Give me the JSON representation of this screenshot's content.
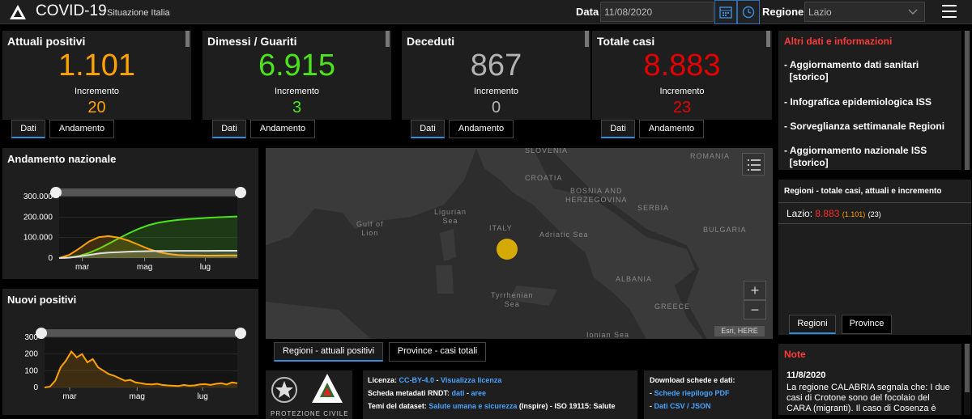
{
  "header": {
    "title": "COVID-19",
    "subtitle": "Situazione Italia",
    "date_label": "Data",
    "date_value": "11/08/2020",
    "region_label": "Regione",
    "region_value": "Lazio"
  },
  "cards": [
    {
      "title": "Attuali positivi",
      "value": "1.101",
      "inc_label": "Incremento",
      "inc_value": "20",
      "color": "#ffa200",
      "tabs": [
        "Dati",
        "Andamento"
      ]
    },
    {
      "title": "Dimessi / Guariti",
      "value": "6.915",
      "inc_label": "Incremento",
      "inc_value": "3",
      "color": "#4be31a",
      "tabs": [
        "Dati",
        "Andamento"
      ]
    },
    {
      "title": "Deceduti",
      "value": "867",
      "inc_label": "Incremento",
      "inc_value": "0",
      "color": "#b3b3b3",
      "tabs": [
        "Dati",
        "Andamento"
      ]
    },
    {
      "title": "Totale casi",
      "value": "8.883",
      "inc_label": "Incremento",
      "inc_value": "23",
      "color": "#e30000",
      "tabs": [
        "Dati",
        "Andamento"
      ]
    }
  ],
  "andamento": {
    "title": "Andamento nazionale"
  },
  "nuovi": {
    "title": "Nuovi positivi"
  },
  "chart_data": [
    {
      "type": "line",
      "title": "Andamento nazionale",
      "ylim": [
        0,
        300000
      ],
      "yticks": [
        "300.000",
        "200.000",
        "100.000",
        "0"
      ],
      "xticks": [
        "mar",
        "mag",
        "lug"
      ],
      "x": [
        0,
        10,
        20,
        30,
        40,
        50,
        60,
        70,
        80,
        90,
        100,
        110,
        120,
        130,
        140,
        150,
        160,
        170,
        180
      ],
      "series": [
        {
          "color": "#4be31a",
          "values": [
            0,
            2000,
            10000,
            25000,
            45000,
            70000,
            95000,
            120000,
            142000,
            160000,
            172000,
            180000,
            186000,
            190000,
            193000,
            196000,
            199000,
            201000,
            203000
          ]
        },
        {
          "color": "#ffa200",
          "values": [
            500,
            15000,
            45000,
            80000,
            102000,
            107000,
            100000,
            85000,
            65000,
            45000,
            30000,
            20000,
            15000,
            13000,
            12500,
            12000,
            12200,
            12500,
            13000
          ]
        },
        {
          "color": "#e0e0e0",
          "values": [
            0,
            2000,
            8000,
            15000,
            22000,
            27000,
            29000,
            31000,
            32500,
            33500,
            34200,
            34700,
            35000,
            35100,
            35200,
            35300,
            35350,
            35400,
            35450
          ]
        }
      ]
    },
    {
      "type": "line",
      "title": "Nuovi positivi",
      "ylim": [
        0,
        300
      ],
      "yticks": [
        "300",
        "200",
        "100",
        "0"
      ],
      "xticks": [
        "mar",
        "mag",
        "lug"
      ],
      "x": [
        0,
        5,
        10,
        15,
        20,
        25,
        30,
        35,
        40,
        45,
        50,
        55,
        60,
        65,
        70,
        75,
        80,
        85,
        90,
        95,
        100,
        105,
        110,
        115,
        120,
        125,
        130,
        135,
        140,
        145,
        150,
        155,
        160,
        165,
        170,
        175,
        180
      ],
      "series": [
        {
          "color": "#ffa200",
          "values": [
            0,
            5,
            40,
            120,
            160,
            215,
            180,
            200,
            150,
            170,
            120,
            100,
            80,
            70,
            55,
            40,
            45,
            30,
            25,
            20,
            18,
            22,
            15,
            12,
            10,
            8,
            15,
            10,
            12,
            18,
            20,
            15,
            22,
            25,
            18,
            30,
            25
          ]
        }
      ]
    }
  ],
  "map": {
    "labels": [
      "SLOVENIA",
      "CROATIA",
      "BOSNIA AND\nHERZEGOVINA",
      "SERBIA",
      "ROMANIA",
      "BULGARIA",
      "ITALY",
      "Ligurian\nSea",
      "Gulf of\nLion",
      "Adriatic Sea",
      "ALBANIA",
      "GREECE",
      "Tyrrhenian\nSea",
      "Ionian Sea"
    ],
    "attribution": "Esri, HERE",
    "zoom_in": "+",
    "zoom_out": "−",
    "tabs": [
      "Regioni - attuali positivi",
      "Province - casi totali"
    ]
  },
  "info": {
    "title": "Altri dati e informazioni",
    "links": [
      "- Aggiornamento dati sanitari\n  [storico]",
      "- Infografica epidemiologica ISS",
      "- Sorveglianza settimanale Regioni",
      "- Aggiornamento nazionale ISS\n  [storico]"
    ]
  },
  "regioni": {
    "title": "Regioni - totale casi, attuali e incremento",
    "name": "Lazio:",
    "total": "8.883",
    "attuali": "(1.101)",
    "inc": "(23)",
    "tabs": [
      "Regioni",
      "Province"
    ]
  },
  "note": {
    "title": "Note",
    "date": "11/8/2020",
    "text": "La regione CALABRIA segnala che: I due casi di Crotone sono del focolaio del CARA (migranti). Il caso di Cosenza è"
  },
  "license": {
    "l1a": "Licenza: ",
    "l1b": "CC-BY-4.0",
    "l1c": " - ",
    "l1d": "Visualizza licenza",
    "l2a": "Scheda metadati RNDT: ",
    "l2b": "dati",
    "l2c": " - ",
    "l2d": "aree",
    "l3a": "Temi del dataset: ",
    "l3b": "Salute umana e sicurezza",
    "l3c": " (Inspire) - ISO 19115: Salute"
  },
  "download": {
    "title": "Download schede e dati:",
    "l1": "Schede riepilogo PDF",
    "l2": "Dati CSV / JSON"
  },
  "protezione": {
    "text": "PROTEZIONE CIVILE"
  }
}
